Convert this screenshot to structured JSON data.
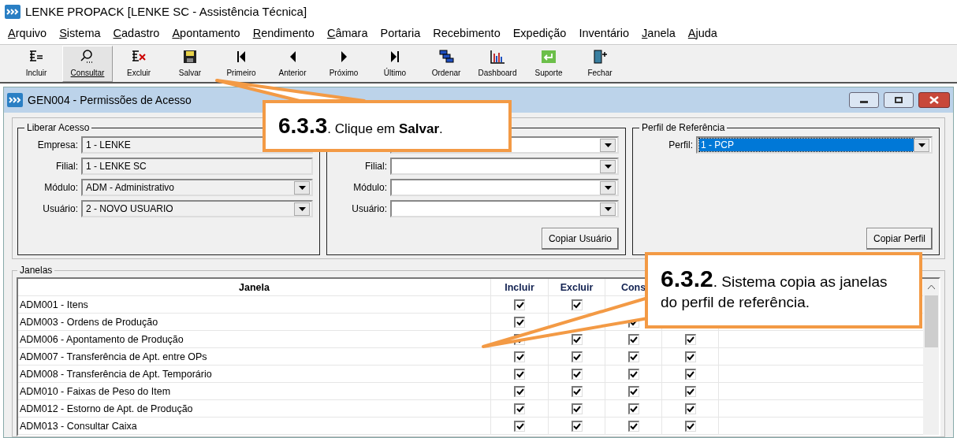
{
  "app_title": "LENKE PROPACK [LENKE SC - Assistência Técnica]",
  "menu": [
    {
      "label": "Arquivo",
      "accel": true
    },
    {
      "label": "Sistema",
      "accel": true
    },
    {
      "label": "Cadastro",
      "accel": true
    },
    {
      "label": "Apontamento",
      "accel": true
    },
    {
      "label": "Rendimento",
      "accel": true
    },
    {
      "label": "Câmara",
      "accel": true
    },
    {
      "label": "Portaria",
      "accel": false
    },
    {
      "label": "Recebimento",
      "accel": false
    },
    {
      "label": "Expedição",
      "accel": false
    },
    {
      "label": "Inventário",
      "accel": false
    },
    {
      "label": "Janela",
      "accel": true
    },
    {
      "label": "Ajuda",
      "accel": true
    }
  ],
  "toolbar": [
    {
      "kind": "add",
      "label": "Incluir",
      "selected": false
    },
    {
      "kind": "search",
      "label": "Consultar",
      "selected": true
    },
    {
      "kind": "delete",
      "label": "Excluir",
      "selected": false
    },
    {
      "kind": "save",
      "label": "Salvar",
      "selected": false
    },
    {
      "kind": "first",
      "label": "Primeiro",
      "selected": false
    },
    {
      "kind": "prev",
      "label": "Anterior",
      "selected": false
    },
    {
      "kind": "next",
      "label": "Próximo",
      "selected": false
    },
    {
      "kind": "last",
      "label": "Último",
      "selected": false
    },
    {
      "kind": "order",
      "label": "Ordenar",
      "selected": false
    },
    {
      "kind": "dashboard",
      "label": "Dashboard",
      "selected": false
    },
    {
      "kind": "support",
      "label": "Suporte",
      "selected": false
    },
    {
      "kind": "exit",
      "label": "Fechar",
      "selected": false
    }
  ],
  "window": {
    "title": "GEN004 - Permissões de Acesso"
  },
  "groups": [
    {
      "title": "Liberar Acesso",
      "fields": [
        {
          "label": "Empresa:",
          "value": "1 - LENKE"
        },
        {
          "label": "Filial:",
          "value": "1 - LENKE SC",
          "dropdown": false
        },
        {
          "label": "Módulo:",
          "value": "ADM - Administrativo",
          "dropdown": true
        },
        {
          "label": "Usuário:",
          "value": "2 - NOVO USUARIO",
          "dropdown": true
        }
      ]
    },
    {
      "fields": [
        {
          "dropdown": true
        },
        {
          "label": "Filial:",
          "dropdown": true
        },
        {
          "label": "Módulo:",
          "dropdown": true
        },
        {
          "label": "Usuário:",
          "dropdown": true
        }
      ],
      "button": "Copiar Usuário"
    },
    {
      "title": "Perfil de Referência",
      "fields": [
        {
          "label": "Perfil:",
          "value": "1 - PCP",
          "dropdown": true,
          "selected": true
        }
      ],
      "button": "Copiar Perfil"
    }
  ],
  "janelas": {
    "title": "Janelas",
    "columns": [
      "Janela",
      "Incluir",
      "Excluir",
      "Cons"
    ],
    "rows": [
      {
        "name": "ADM001 - Itens",
        "incluir": true,
        "excluir": true
      },
      {
        "name": "ADM003 - Ordens de Produção",
        "incluir": true,
        "cons": true
      },
      {
        "name": "ADM006 - Apontamento de Produção",
        "incluir": true,
        "excluir": true,
        "cons": true,
        "column_5": true
      },
      {
        "name": "ADM007 - Transferência de Apt. entre OPs",
        "incluir": true,
        "excluir": true,
        "cons": true,
        "column_5": true
      },
      {
        "name": "ADM008 - Transferência de Apt. Temporário",
        "incluir": true,
        "excluir": true,
        "cons": true,
        "column_5": true
      },
      {
        "name": "ADM010 - Faixas de Peso do Item",
        "incluir": true,
        "excluir": true,
        "cons": true,
        "column_5": true
      },
      {
        "name": "ADM012 - Estorno de Apt. de Produção",
        "incluir": true,
        "excluir": true,
        "cons": true,
        "column_5": true
      },
      {
        "name": "ADM013 - Consultar Caixa",
        "incluir": true,
        "excluir": true,
        "cons": true,
        "column_5": true
      }
    ]
  },
  "callouts": [
    {
      "number": "6.3.3",
      "text": ". Clique em **Salvar**."
    },
    {
      "number": "6.3.2",
      "text": ". Sistema copia as janelas do perfil de referência."
    }
  ]
}
